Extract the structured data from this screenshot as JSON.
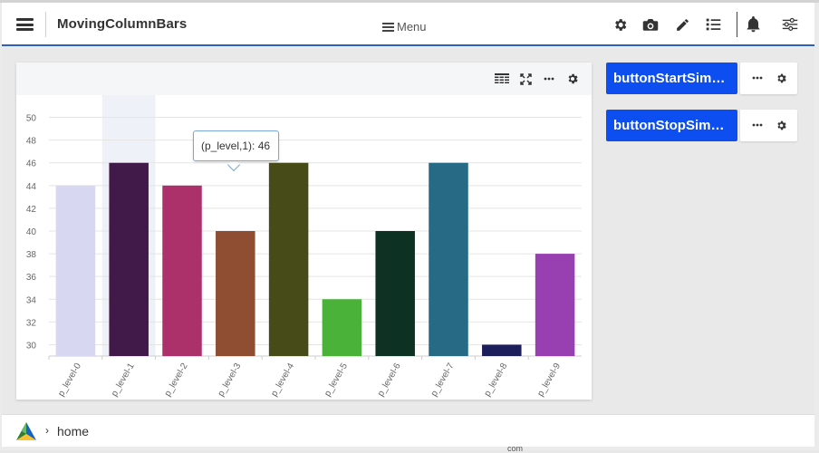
{
  "app": {
    "title": "MovingColumnBars",
    "menu_label": "Menu"
  },
  "header_icons": [
    "gear-icon",
    "camera-icon",
    "pencil-icon",
    "list-icon",
    "bell-icon",
    "sliders-icon"
  ],
  "widget_tools": [
    "table-icon",
    "expand-icon",
    "more-icon",
    "gear-icon"
  ],
  "tooltip": {
    "text": "(p_level,1): 46"
  },
  "buttons": {
    "start": "buttonStartSim…",
    "stop": "buttonStopSim…"
  },
  "breadcrumb": {
    "home": "home"
  },
  "footer_fragment": "com",
  "colors": {
    "accent": "#2f5fbd",
    "button": "#0d4ef0"
  },
  "chart_data": {
    "type": "bar",
    "categories": [
      "p_level-0",
      "p_level-1",
      "p_level-2",
      "p_level-3",
      "p_level-4",
      "p_level-5",
      "p_level-6",
      "p_level-7",
      "p_level-8",
      "p_level-9"
    ],
    "values": [
      44,
      46,
      44,
      40,
      46,
      34,
      40,
      46,
      30,
      38
    ],
    "colors": [
      "#d8d7f2",
      "#421a4a",
      "#ac316a",
      "#8f4e31",
      "#474b18",
      "#4bb239",
      "#0d3123",
      "#266a85",
      "#1c1d5b",
      "#983fb1"
    ],
    "yticks": [
      30,
      32,
      34,
      36,
      38,
      40,
      42,
      44,
      46,
      48,
      50
    ],
    "ylim": [
      29,
      51
    ],
    "highlighted_category": "p_level-1",
    "grid": true,
    "legend": "none"
  }
}
